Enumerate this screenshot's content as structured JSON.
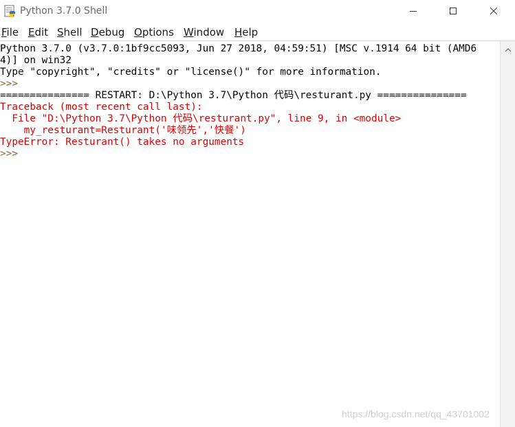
{
  "window": {
    "title": "Python 3.7.0 Shell",
    "icon": "python-idle-icon",
    "controls": {
      "minimize": "minimize-icon",
      "maximize": "maximize-icon",
      "close": "close-icon"
    }
  },
  "menu": {
    "items": [
      {
        "label": "File",
        "accel": "F",
        "rest": "ile"
      },
      {
        "label": "Edit",
        "accel": "E",
        "rest": "dit"
      },
      {
        "label": "Shell",
        "accel": "S",
        "rest": "hell"
      },
      {
        "label": "Debug",
        "accel": "D",
        "rest": "ebug"
      },
      {
        "label": "Options",
        "accel": "O",
        "rest": "ptions"
      },
      {
        "label": "Window",
        "accel": "W",
        "rest": "indow"
      },
      {
        "label": "Help",
        "accel": "H",
        "rest": "elp"
      }
    ]
  },
  "shell": {
    "lines": [
      {
        "text": "Python 3.7.0 (v3.7.0:1bf9cc5093, Jun 27 2018, 04:59:51) [MSC v.1914 64 bit (AMD6",
        "style": "black"
      },
      {
        "text": "4)] on win32",
        "style": "black"
      },
      {
        "text": "Type \"copyright\", \"credits\" or \"license()\" for more information.",
        "style": "black"
      },
      {
        "text": ">>>",
        "style": "prompt"
      },
      {
        "text": "=============== RESTART: D:\\Python 3.7\\Python 代码\\resturant.py ===============",
        "style": "restart"
      },
      {
        "text": "Traceback (most recent call last):",
        "style": "red"
      },
      {
        "text": "  File \"D:\\Python 3.7\\Python 代码\\resturant.py\", line 9, in <module>",
        "style": "red"
      },
      {
        "text": "    my_resturant=Resturant('味领先','快餐')",
        "style": "red"
      },
      {
        "text": "TypeError: Resturant() takes no arguments",
        "style": "red"
      },
      {
        "text": ">>>",
        "style": "prompt"
      }
    ]
  },
  "colors": {
    "error": "#e00000",
    "prompt": "#8c6b3f",
    "text": "#000000"
  },
  "watermark": "https://blog.csdn.net/qq_43701002"
}
